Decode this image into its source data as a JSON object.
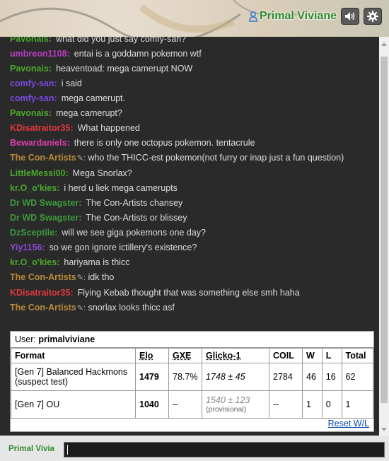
{
  "header": {
    "username": "Primal Viviane",
    "sound_icon": "speaker-icon",
    "settings_icon": "gear-icon"
  },
  "messages": [
    {
      "user": "Pavonais:",
      "color": "#4aa82c",
      "text": "what did you just say comfy-san?",
      "pencil": false
    },
    {
      "user": "umbreon1108:",
      "color": "#b83dc2",
      "text": "entai is a goddamn pokemon wtf",
      "pencil": false
    },
    {
      "user": "Pavonais:",
      "color": "#4aa82c",
      "text": "heaventoad: mega camerupt NOW",
      "pencil": false
    },
    {
      "user": "comfy-san:",
      "color": "#7a4ae0",
      "text": "i said",
      "pencil": false
    },
    {
      "user": "comfy-san:",
      "color": "#7a4ae0",
      "text": "mega camerupt.",
      "pencil": false
    },
    {
      "user": "Pavonais:",
      "color": "#4aa82c",
      "text": "mega camerupt?",
      "pencil": false
    },
    {
      "user": "KDisatraitor35:",
      "color": "#e0383a",
      "text": "What happened",
      "pencil": false
    },
    {
      "user": "Bewardaniels:",
      "color": "#d83ea8",
      "text": "there is only one octopus pokemon. tentacrule",
      "pencil": false
    },
    {
      "user": "The Con-Artists",
      "color": "#b88a3c",
      "text": "who the THICC-est pokemon(not furry or inap just a fun question)",
      "pencil": true
    },
    {
      "user": "LittleMessi00:",
      "color": "#4aa82c",
      "text": "Mega Snorlax?",
      "pencil": false
    },
    {
      "user": "kr.O_o'kies:",
      "color": "#4aa82c",
      "text": "i herd u liek mega camerupts",
      "pencil": false
    },
    {
      "user": "Dr WD Swagster:",
      "color": "#3c9a3c",
      "text": "The Con-Artists chansey",
      "pencil": false
    },
    {
      "user": "Dr WD Swagster:",
      "color": "#3c9a3c",
      "text": "The Con-Artists or blissey",
      "pencil": false
    },
    {
      "user": "DzSceptile:",
      "color": "#3c9a3c",
      "text": "will we see giga pokemons one day?",
      "pencil": false
    },
    {
      "user": "Yiy1156:",
      "color": "#8a4ad0",
      "text": "so we gon ignore ictillery's existence?",
      "pencil": false
    },
    {
      "user": "kr.O_o'kies:",
      "color": "#4aa82c",
      "text": "hariyama is thicc",
      "pencil": false
    },
    {
      "user": "The Con-Artists",
      "color": "#b88a3c",
      "text": "idk tho",
      "pencil": true
    },
    {
      "user": "KDisatraitor35:",
      "color": "#e0383a",
      "text": "Flying Kebab thought that was something else smh haha",
      "pencil": false
    },
    {
      "user": "The Con-Artists",
      "color": "#b88a3c",
      "text": "snorlax looks thicc asf",
      "pencil": true
    }
  ],
  "ranking": {
    "user_label": "User:",
    "user_value": "primalviviane",
    "headers": [
      "Format",
      "Elo",
      "GXE",
      "Glicko-1",
      "COIL",
      "W",
      "L",
      "Total"
    ],
    "rows": [
      {
        "format": "[Gen 7] Balanced Hackmons (suspect test)",
        "elo": "1479",
        "gxe": "78.7%",
        "glicko": "1748 ± 45",
        "glicko_note": "",
        "coil": "2784",
        "w": "46",
        "l": "16",
        "total": "62"
      },
      {
        "format": "[Gen 7] OU",
        "elo": "1040",
        "gxe": "–",
        "glicko": "1540 ± 123",
        "glicko_note": "(provisional)",
        "coil": "--",
        "w": "1",
        "l": "0",
        "total": "1"
      }
    ],
    "reset_label": "Reset W/L"
  },
  "input_bar": {
    "name": "Primal Vivia",
    "value": ""
  }
}
